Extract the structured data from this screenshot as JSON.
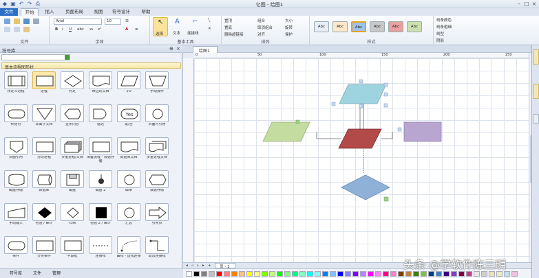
{
  "window": {
    "title": "亿图 - 绘图1"
  },
  "ribbon_tabs": [
    "文件",
    "开始",
    "插入",
    "页面布局",
    "视图",
    "符号设计",
    "帮助"
  ],
  "ribbon": {
    "groups": [
      "文件",
      "字体",
      "基本工具",
      "排列",
      "样式"
    ],
    "font_name": "Arial",
    "font_size": "10",
    "tools": [
      "选择",
      "文本",
      "连接线"
    ],
    "arrange_items": [
      "置顶",
      "置底",
      "删除超链接",
      "组合",
      "取消组合",
      "对齐",
      "居中绘图",
      "大小",
      "旋转",
      "保护"
    ],
    "style_labels": [
      "Abc",
      "Abc",
      "Abc",
      "Abc",
      "Abc",
      "Abc"
    ],
    "style_colors": [
      "#e8eef8",
      "#fde8cc",
      "#9fc3e8",
      "#c8c8c8",
      "#e8a0a0",
      "#cde0b0"
    ],
    "format_items": [
      "线条颜色",
      "线条粗细",
      "线型",
      "阴影"
    ]
  },
  "left_panel": {
    "title": "符号库",
    "category": "基本流程图形状",
    "shapes": [
      {
        "label": "预定义进程",
        "icon": "predef"
      },
      {
        "label": "进程",
        "icon": "rect"
      },
      {
        "label": "判定",
        "icon": "diamond"
      },
      {
        "label": "带边的文档",
        "icon": "doc"
      },
      {
        "label": "I/O",
        "icon": "parallelogram"
      },
      {
        "label": "手动操作",
        "icon": "trapezoid"
      },
      {
        "label": "终结符",
        "icon": "terminal"
      },
      {
        "label": "非离子文档",
        "icon": "triangle"
      },
      {
        "label": "显示内容",
        "icon": "display"
      },
      {
        "label": "延迟",
        "icon": "delay"
      },
      {
        "label": "是/否",
        "icon": "yesno"
      },
      {
        "label": "页面内引用",
        "icon": "circle"
      },
      {
        "label": "页面引用",
        "icon": "offpage"
      },
      {
        "label": "分段进程",
        "icon": "rect"
      },
      {
        "label": "多重进程/文档",
        "icon": "multirect"
      },
      {
        "label": "准备流程 - 数据存储",
        "icon": "rect"
      },
      {
        "label": "数据库文档",
        "icon": "doc"
      },
      {
        "label": "多重进程文档",
        "icon": "multidoc"
      },
      {
        "label": "磁盘存储",
        "icon": "cylinder"
      },
      {
        "label": "数据库",
        "icon": "hcylinder"
      },
      {
        "label": "磁盘",
        "icon": "floppy"
      },
      {
        "label": "磁盘 2",
        "icon": "pin"
      },
      {
        "label": "磁带",
        "icon": "circle"
      },
      {
        "label": "数据存储",
        "icon": "hexagon"
      },
      {
        "label": "手动输入",
        "icon": "manualinput"
      },
      {
        "label": "检验 / 审计",
        "icon": "blackdiamond"
      },
      {
        "label": "归档",
        "icon": "diamondsmall"
      },
      {
        "label": "检验 2 / 审计",
        "icon": "blacksquare"
      },
      {
        "label": "汇总",
        "icon": "circle"
      },
      {
        "label": "引用页",
        "icon": "arrow"
      },
      {
        "label": "事件",
        "icon": "terminal"
      },
      {
        "label": "分类事件",
        "icon": "rect"
      },
      {
        "label": "字段框",
        "icon": "rect"
      },
      {
        "label": "连接线",
        "icon": "dashline"
      },
      {
        "label": "曲线 - 直线连接",
        "icon": "curve"
      },
      {
        "label": "动态连接线",
        "icon": "dynline"
      }
    ],
    "footer_tabs": [
      "符号库",
      "文件",
      "管理"
    ]
  },
  "document": {
    "tab_label": "绘图1",
    "page_tab": "页 - 1",
    "ruler_numbers": [
      "0",
      "50",
      "100",
      "150",
      "200",
      "250"
    ]
  },
  "diagram": {
    "colors": {
      "top_parallelogram": "#9ed4e0",
      "left_parallelogram": "#c4dca0",
      "center_parallelogram": "#b24a4a",
      "right_rect": "#b9a6d0",
      "bottom_diamond": "#8fb1d8"
    }
  },
  "palette_colors": [
    "#ffffff",
    "#000000",
    "#808080",
    "#c0c0c0",
    "#ff0000",
    "#ff8080",
    "#ff8000",
    "#ffc080",
    "#ffff00",
    "#ffff80",
    "#80ff00",
    "#c0ff80",
    "#00ff00",
    "#80ff80",
    "#00ff80",
    "#80ffc0",
    "#00ffff",
    "#80ffff",
    "#0080ff",
    "#80c0ff",
    "#0000ff",
    "#8080ff",
    "#8000ff",
    "#c080ff",
    "#ff00ff",
    "#ff80ff",
    "#ff0080",
    "#ff80c0",
    "#804000",
    "#c08040",
    "#408000",
    "#80c040",
    "#004080",
    "#4080c0",
    "#400080",
    "#8040c0",
    "#800040",
    "#c04080",
    "#e8e8e8",
    "#d0d0d0",
    "#f0e0c0",
    "#e0f0c0",
    "#c0e0f0",
    "#f0c0e0"
  ],
  "right_dock": [
    "符号库",
    "文件"
  ],
  "watermark": "头条 @学软件陈三明"
}
